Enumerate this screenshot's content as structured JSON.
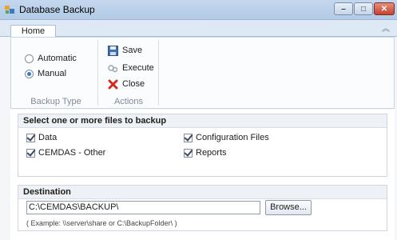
{
  "window": {
    "title": "Database Backup",
    "icon": "database-app-icon",
    "buttons": {
      "minimize": "–",
      "maximize": "□",
      "close": "✕"
    }
  },
  "ribbon": {
    "tabs": [
      {
        "label": "Home"
      }
    ],
    "collapse_glyph": "︽",
    "backup_type": {
      "label": "Backup Type",
      "options": [
        {
          "label": "Automatic",
          "selected": false
        },
        {
          "label": "Manual",
          "selected": true
        }
      ]
    },
    "actions": {
      "label": "Actions",
      "items": [
        {
          "label": "Save",
          "icon": "save-icon"
        },
        {
          "label": "Execute",
          "icon": "execute-icon"
        },
        {
          "label": "Close",
          "icon": "close-icon"
        }
      ]
    }
  },
  "files_section": {
    "header": "Select one or more files to backup",
    "items": [
      {
        "label": "Data",
        "checked": true
      },
      {
        "label": "CEMDAS - Other",
        "checked": true
      },
      {
        "label": "Configuration Files",
        "checked": true
      },
      {
        "label": "Reports",
        "checked": true
      }
    ]
  },
  "destination": {
    "header": "Destination",
    "path": "C:\\CEMDAS\\BACKUP\\",
    "browse_label": "Browse...",
    "example": "( Example:  \\\\server\\share   or   C:\\BackupFolder\\ )"
  },
  "colors": {
    "titlebar": "#c4d7ee",
    "selection": "#3c78c8",
    "close_button": "#c5442f"
  }
}
